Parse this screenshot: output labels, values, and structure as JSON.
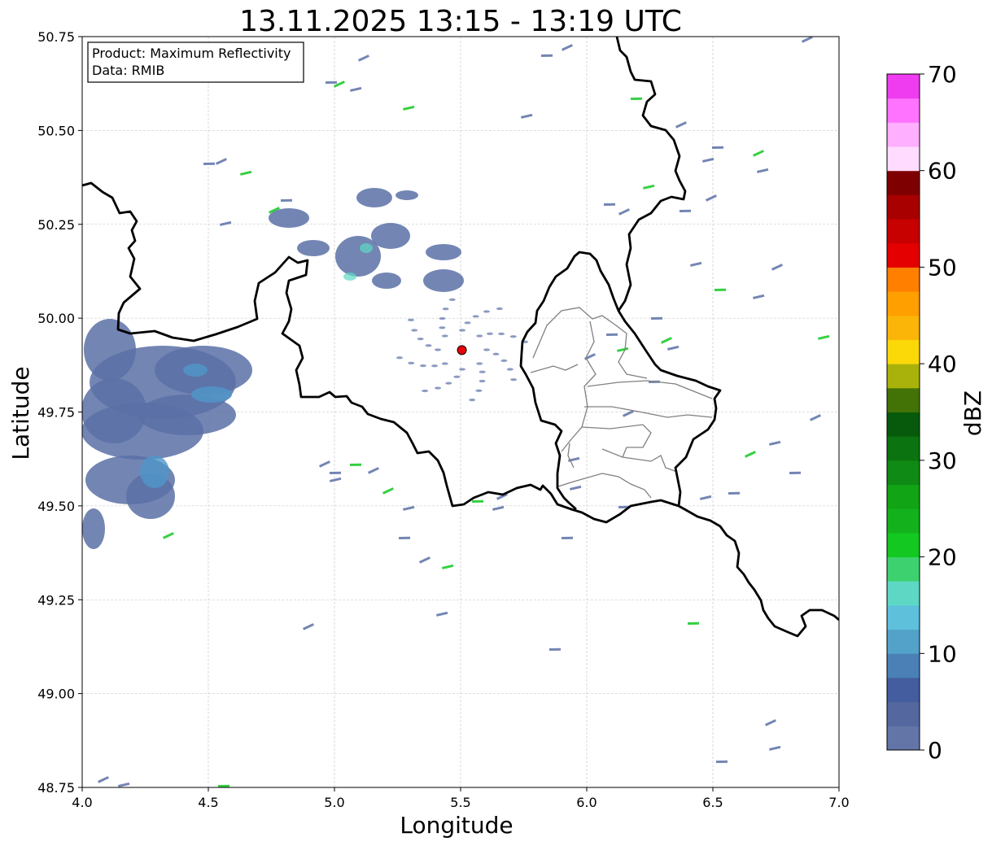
{
  "title": "13.11.2025 13:15 - 13:19 UTC",
  "xlabel": "Longitude",
  "ylabel": "Latitude",
  "xlim": [
    4.0,
    7.0
  ],
  "ylim": [
    48.75,
    50.75
  ],
  "xticks": [
    "4.0",
    "4.5",
    "5.0",
    "5.5",
    "6.0",
    "6.5",
    "7.0"
  ],
  "yticks": [
    "48.75",
    "49.00",
    "49.25",
    "49.50",
    "49.75",
    "50.00",
    "50.25",
    "50.50",
    "50.75"
  ],
  "info_box": {
    "product": "Product: Maximum Reflectivity",
    "data": "Data: RMIB"
  },
  "radar_site": {
    "lon": 5.505,
    "lat": 49.915,
    "color": "#e8000b"
  },
  "colorbar": {
    "label": "dBZ",
    "min": 0,
    "max": 70,
    "ticks": [
      "0",
      "10",
      "20",
      "30",
      "40",
      "50",
      "60",
      "70"
    ],
    "colors": [
      "#6375a6",
      "#54689f",
      "#445d9f",
      "#4a80b6",
      "#53a2c9",
      "#5fc0db",
      "#5ed8c5",
      "#3dd26f",
      "#12c821",
      "#13b21d",
      "#11a414",
      "#0e8a15",
      "#0b7310",
      "#075a0b",
      "#437306",
      "#a9b20b",
      "#fbd909",
      "#fbb509",
      "#ff9f00",
      "#ff7f00",
      "#e40000",
      "#c70000",
      "#a80000",
      "#7f0000",
      "#ffdcff",
      "#ffafff",
      "#ff73ff",
      "#f03cf0"
    ]
  },
  "map_colors": {
    "border": "#000000",
    "province": "#808080",
    "grid": "#bfbfbf",
    "echo_light": "#5a70a6",
    "echo_mid": "#4f96c8",
    "echo_cyan": "#5ed8c5",
    "echo_green": "#12c821"
  }
}
